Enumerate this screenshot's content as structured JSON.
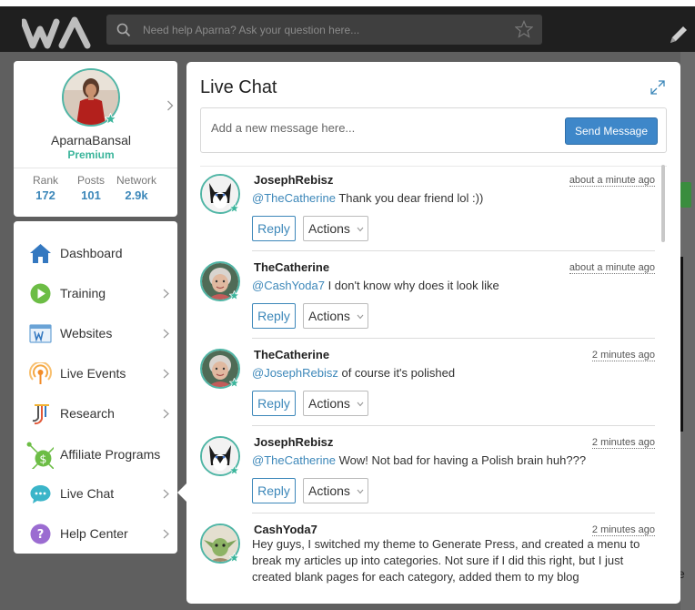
{
  "header": {
    "logo_label": "WA",
    "search_placeholder": "Need help Aparna? Ask your question here..."
  },
  "profile": {
    "name": "AparnaBansal",
    "tier": "Premium",
    "stats": [
      {
        "label": "Rank",
        "value": "172"
      },
      {
        "label": "Posts",
        "value": "101"
      },
      {
        "label": "Network",
        "value": "2.9k"
      }
    ]
  },
  "menu": {
    "items": [
      {
        "label": "Dashboard",
        "icon": "home-icon",
        "has_chevron": false
      },
      {
        "label": "Training",
        "icon": "play-icon",
        "has_chevron": true
      },
      {
        "label": "Websites",
        "icon": "website-icon",
        "has_chevron": true
      },
      {
        "label": "Live Events",
        "icon": "broadcast-icon",
        "has_chevron": true
      },
      {
        "label": "Research",
        "icon": "research-icon",
        "has_chevron": true
      },
      {
        "label": "Affiliate Programs",
        "icon": "affiliate-network-icon",
        "has_chevron": false
      },
      {
        "label": "Live Chat",
        "icon": "chat-bubble-icon",
        "has_chevron": true
      },
      {
        "label": "Help Center",
        "icon": "help-icon",
        "has_chevron": true
      }
    ]
  },
  "chat": {
    "title": "Live Chat",
    "compose_placeholder": "Add a new message here...",
    "send_label": "Send Message",
    "reply_label": "Reply",
    "actions_label": "Actions",
    "messages": [
      {
        "user": "JosephRebisz",
        "time": "about a minute ago",
        "mention": "@TheCatherine",
        "text": " Thank you dear friend lol :))",
        "avatar": "husky"
      },
      {
        "user": "TheCatherine",
        "time": "about a minute ago",
        "mention": "@CashYoda7",
        "text": " I don't know why does it look like",
        "avatar": "lady"
      },
      {
        "user": "TheCatherine",
        "time": "2 minutes ago",
        "mention": "@JosephRebisz",
        "text": " of course it's polished",
        "avatar": "lady"
      },
      {
        "user": "JosephRebisz",
        "time": "2 minutes ago",
        "mention": "@TheCatherine",
        "text": " Wow! Not bad for having a Polish brain huh???",
        "avatar": "husky"
      },
      {
        "user": "CashYoda7",
        "time": "2 minutes ago",
        "mention": "",
        "text": "Hey guys, I switched my theme to Generate Press, and created a menu to break my articles up into categories. Not sure if I did this right, but I just created blank pages for each category, added them to my blog",
        "avatar": "yoda"
      }
    ]
  },
  "colors": {
    "accent": "#3c87b9",
    "teal": "#3bb59b",
    "send_button": "#3e87c9",
    "topbar": "#1f1f1f"
  }
}
